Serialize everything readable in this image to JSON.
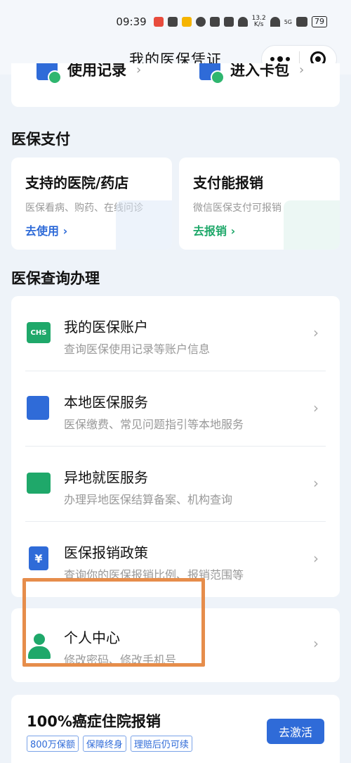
{
  "status_bar": {
    "time": "09:39",
    "net_speed_value": "13.2",
    "net_speed_unit": "K/s",
    "signal_label": "5G",
    "battery": "79"
  },
  "nav": {
    "title": "我的医保凭证"
  },
  "top_card": {
    "left_label": "使用记录",
    "left_chevron": "›",
    "right_label": "进入卡包",
    "right_chevron": "›"
  },
  "payment_section": {
    "title": "医保支付",
    "cards": [
      {
        "title": "支持的医院/药店",
        "subtitle": "医保看病、购药、在线问诊",
        "link": "去使用 ›"
      },
      {
        "title": "支付能报销",
        "subtitle": "微信医保支付可报销",
        "link": "去报销 ›"
      }
    ]
  },
  "query_section": {
    "title": "医保查询办理",
    "items": [
      {
        "title": "我的医保账户",
        "subtitle": "查询医保使用记录等账户信息",
        "icon_text": "CHS"
      },
      {
        "title": "本地医保服务",
        "subtitle": "医保缴费、常见问题指引等本地服务"
      },
      {
        "title": "异地就医服务",
        "subtitle": "办理异地医保结算备案、机构查询"
      },
      {
        "title": "医保报销政策",
        "subtitle": "查询你的医保报销比例、报销范围等",
        "icon_text": "¥"
      }
    ],
    "chevron": "›"
  },
  "personal_center": {
    "title": "个人中心",
    "subtitle": "修改密码、修改手机号",
    "chevron": "›"
  },
  "promo": {
    "title": "100%癌症住院报销",
    "tags": [
      "800万保额",
      "保障终身",
      "理赔后仍可续"
    ],
    "button": "去激活"
  },
  "colors": {
    "primary_blue": "#2f6bd8",
    "green": "#1fa86a",
    "highlight_orange": "#e68d4b",
    "background": "#eef3f9"
  }
}
